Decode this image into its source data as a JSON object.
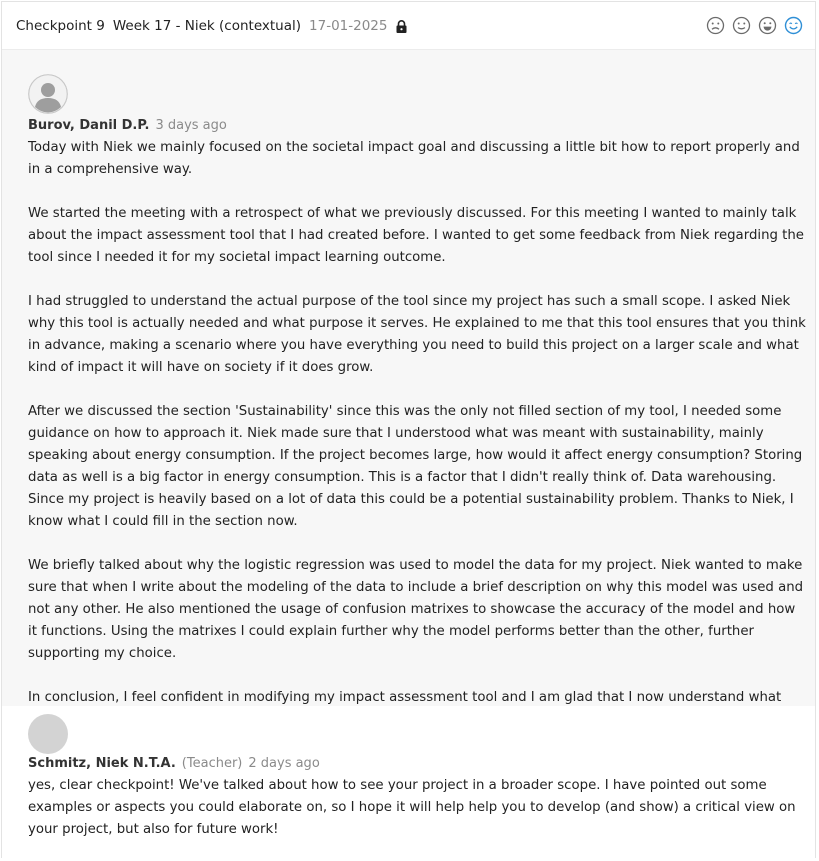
{
  "header": {
    "checkpoint": "Checkpoint 9",
    "week_title": "Week 17 - Niek (contextual)",
    "date": "17-01-2025",
    "lock_icon": "lock-icon",
    "moods": [
      {
        "icon": "sad-face-icon"
      },
      {
        "icon": "neutral-face-icon"
      },
      {
        "icon": "happy-face-icon"
      },
      {
        "icon": "very-happy-face-icon",
        "selected": true
      }
    ],
    "accent_color": "#2f8fd6"
  },
  "posts": [
    {
      "author": "Burov, Danil D.P.",
      "role": "",
      "time": "3 days ago",
      "paragraphs": [
        "Today with Niek we mainly focused on the societal impact goal and discussing a little bit how to report properly and in a comprehensive way.",
        "We started the meeting with a retrospect of what we previously discussed. For this meeting I wanted to mainly talk about the impact assessment tool that I had created before. I wanted to get some feedback from Niek regarding the tool since I needed it for my societal impact learning outcome.",
        "I had struggled to understand the actual purpose of the tool since my project has such a small scope. I asked Niek why this tool is actually needed and what purpose it serves. He explained to me that this tool ensures that you think in advance, making a scenario where you have everything you need to build this project on a larger scale and what kind of impact it will have on society if it does grow.",
        "After we discussed the section 'Sustainability' since this was the only not filled section of my tool, I needed some guidance on how to approach it. Niek made sure that I understood what was meant with sustainability, mainly speaking about energy consumption. If the project becomes large, how would it affect energy consumption? Storing data as well is a big factor in energy consumption. This is a factor that I didn't really think of. Data warehousing. Since my project is heavily based on a lot of data this could be a potential sustainability problem. Thanks to Niek, I know what I could fill in the section now.",
        "We briefly talked about why the logistic regression was used to model the data for my project. Niek wanted to make sure that when I write about the modeling of the data to include a brief description on why this model was used and not any other. He also mentioned the usage of confusion matrixes to showcase the accuracy of the model and how it functions. Using the matrixes I could explain further why the model performs better than the other, further supporting my choice.",
        "In conclusion, I feel confident in modifying my impact assessment tool and I am glad that I now understand what purpose the tool servers."
      ]
    },
    {
      "author": "Schmitz, Niek N.T.A.",
      "role": "(Teacher)",
      "time": "2 days ago",
      "paragraphs": [
        "yes, clear checkpoint! We've talked about how to see your project in a broader scope. I have pointed out some examples or aspects you could elaborate on, so I hope it will help help you to develop (and show) a critical view on your project, but also for future work!"
      ]
    }
  ]
}
